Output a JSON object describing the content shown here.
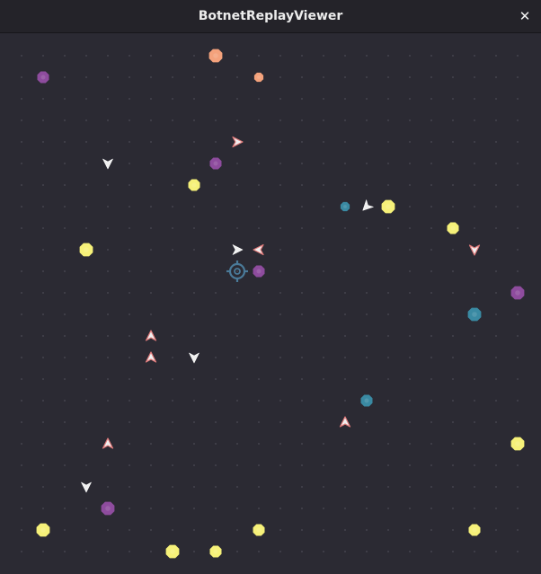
{
  "window": {
    "title": "BotnetReplayViewer",
    "close_glyph": "✕"
  },
  "colors": {
    "background": "#2b2a33",
    "grid_dot": "#45444f",
    "salmon": "#f4a27c",
    "purple": "#8e4c9e",
    "yellow": "#f6f179",
    "teal": "#3a8aa3",
    "arrow_fill": "#f0f0f0",
    "arrow_outline": "#e27c7c",
    "crosshair": "#4a7a99"
  },
  "entities": [
    {
      "kind": "blob",
      "color": "salmon",
      "col": 10,
      "row": 1,
      "size": "large"
    },
    {
      "kind": "blob",
      "color": "salmon",
      "col": 12,
      "row": 2,
      "size": "small"
    },
    {
      "kind": "blob",
      "color": "purple",
      "col": 2,
      "row": 2,
      "size": "medium"
    },
    {
      "kind": "arrow",
      "dir": "right",
      "col": 11,
      "row": 5,
      "outline": true
    },
    {
      "kind": "arrow",
      "dir": "down",
      "col": 5,
      "row": 6
    },
    {
      "kind": "blob",
      "color": "purple",
      "col": 10,
      "row": 6,
      "size": "medium"
    },
    {
      "kind": "blob",
      "color": "yellow",
      "col": 9,
      "row": 7,
      "size": "medium"
    },
    {
      "kind": "blob",
      "color": "teal",
      "col": 16,
      "row": 8,
      "size": "small"
    },
    {
      "kind": "arrow",
      "dir": "down-left",
      "col": 17,
      "row": 8
    },
    {
      "kind": "blob",
      "color": "yellow",
      "col": 18,
      "row": 8,
      "size": "large"
    },
    {
      "kind": "blob",
      "color": "yellow",
      "col": 21,
      "row": 9,
      "size": "medium"
    },
    {
      "kind": "arrow",
      "dir": "down",
      "col": 22,
      "row": 10,
      "outline": true
    },
    {
      "kind": "blob",
      "color": "yellow",
      "col": 4,
      "row": 10,
      "size": "large"
    },
    {
      "kind": "arrow",
      "dir": "right",
      "col": 11,
      "row": 10
    },
    {
      "kind": "arrow",
      "dir": "left",
      "col": 12,
      "row": 10,
      "outline": true
    },
    {
      "kind": "crosshair",
      "col": 11,
      "row": 11
    },
    {
      "kind": "blob",
      "color": "purple",
      "col": 12,
      "row": 11,
      "size": "medium"
    },
    {
      "kind": "blob",
      "color": "purple",
      "col": 24,
      "row": 12,
      "size": "large"
    },
    {
      "kind": "blob",
      "color": "teal",
      "col": 22,
      "row": 13,
      "size": "large"
    },
    {
      "kind": "arrow",
      "dir": "up",
      "col": 7,
      "row": 14,
      "outline": true
    },
    {
      "kind": "arrow",
      "dir": "up",
      "col": 7,
      "row": 15,
      "outline": true
    },
    {
      "kind": "arrow",
      "dir": "down",
      "col": 9,
      "row": 15
    },
    {
      "kind": "blob",
      "color": "teal",
      "col": 17,
      "row": 17,
      "size": "medium"
    },
    {
      "kind": "arrow",
      "dir": "up",
      "col": 16,
      "row": 18,
      "outline": true
    },
    {
      "kind": "arrow",
      "dir": "up",
      "col": 5,
      "row": 19,
      "outline": true
    },
    {
      "kind": "blob",
      "color": "yellow",
      "col": 24,
      "row": 19,
      "size": "large"
    },
    {
      "kind": "arrow",
      "dir": "down",
      "col": 4,
      "row": 21
    },
    {
      "kind": "blob",
      "color": "purple",
      "col": 5,
      "row": 22,
      "size": "large"
    },
    {
      "kind": "blob",
      "color": "yellow",
      "col": 2,
      "row": 23,
      "size": "large"
    },
    {
      "kind": "blob",
      "color": "yellow",
      "col": 12,
      "row": 23,
      "size": "medium"
    },
    {
      "kind": "blob",
      "color": "yellow",
      "col": 22,
      "row": 23,
      "size": "medium"
    },
    {
      "kind": "blob",
      "color": "yellow",
      "col": 8,
      "row": 24,
      "size": "large"
    },
    {
      "kind": "blob",
      "color": "yellow",
      "col": 10,
      "row": 24,
      "size": "medium"
    }
  ]
}
